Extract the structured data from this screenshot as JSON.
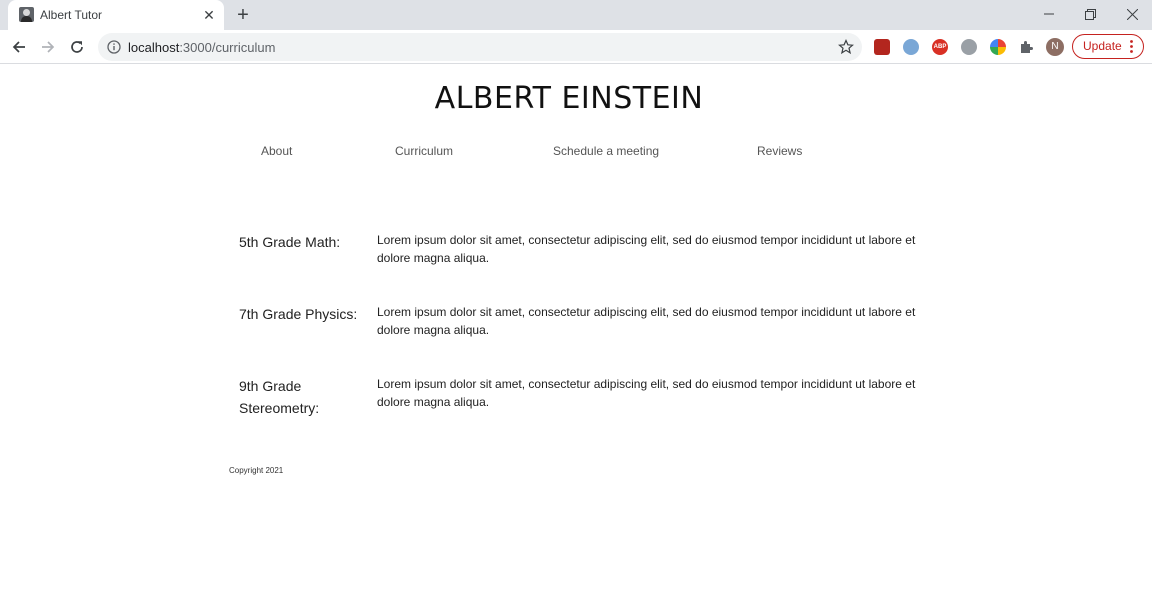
{
  "browser": {
    "tab_title": "Albert Tutor",
    "url_host": "localhost",
    "url_path": ":3000/curriculum",
    "avatar_letter": "N",
    "update_label": "Update",
    "extension_icons": [
      "flash-extension-icon",
      "shield-extension-icon",
      "adblock-plus-icon",
      "settings-extension-icon",
      "color-picker-extension-icon",
      "extensions-puzzle-icon"
    ]
  },
  "site": {
    "title": "ALBERT EINSTEIN",
    "nav": [
      "About",
      "Curriculum",
      "Schedule a meeting",
      "Reviews"
    ],
    "courses": [
      {
        "name": "5th Grade Math:",
        "description": "Lorem ipsum dolor sit amet, consectetur adipiscing elit, sed do eiusmod tempor incididunt ut labore et dolore magna aliqua."
      },
      {
        "name": "7th Grade Physics:",
        "description": "Lorem ipsum dolor sit amet, consectetur adipiscing elit, sed do eiusmod tempor incididunt ut labore et dolore magna aliqua."
      },
      {
        "name": "9th Grade Stereometry:",
        "description": "Lorem ipsum dolor sit amet, consectetur adipiscing elit, sed do eiusmod tempor incididunt ut labore et dolore magna aliqua."
      }
    ],
    "footer": "Copyright 2021"
  }
}
